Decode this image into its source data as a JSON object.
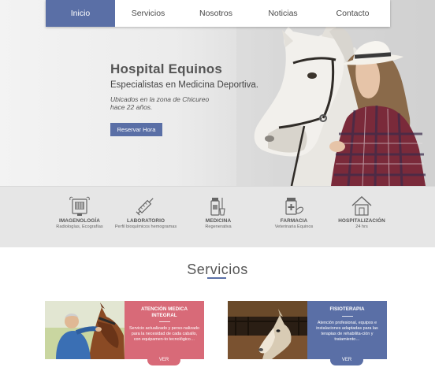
{
  "colors": {
    "accent": "#5a6fa6",
    "card_pink": "#d86a78",
    "card_blue": "#5a6fa6",
    "feature_band": "#e6e6e6"
  },
  "nav": {
    "items": [
      {
        "label": "Inicio",
        "active": true
      },
      {
        "label": "Servicios",
        "active": false
      },
      {
        "label": "Nosotros",
        "active": false
      },
      {
        "label": "Noticias",
        "active": false
      },
      {
        "label": "Contacto",
        "active": false
      }
    ]
  },
  "hero": {
    "title": "Hospital Equinos",
    "subtitle": "Especialistas en Medicina  Deportiva.",
    "description": "Ubicados en la zona de Chicureo hace 22 años.",
    "button": "Reservar Hora"
  },
  "features": [
    {
      "icon": "x-ray-monitor-icon",
      "title": "IMAGENOLOGÍA",
      "subtitle": "Radiologías, Ecografías"
    },
    {
      "icon": "syringe-icon",
      "title": "LABORATORIO",
      "subtitle": "Perfil bioquímicos hemogramas"
    },
    {
      "icon": "medicine-bottle-icon",
      "title": "MEDICINA",
      "subtitle": "Regenerativa"
    },
    {
      "icon": "pharmacy-icon",
      "title": "FARMACIA",
      "subtitle": "Veterinaria Equinos"
    },
    {
      "icon": "house-icon",
      "title": "HOSPITALIZACIÓN",
      "subtitle": "24 hrs"
    }
  ],
  "services": {
    "title": "Servicios",
    "cards": [
      {
        "title": "ATENCIÓN MEDICA INTEGRAL",
        "description": "Servicio actualizado y perso-nalizado para la necesidad de cada caballo, con equipamen-to tecnológico…",
        "button": "VER"
      },
      {
        "title": "FISIOTERAPIA",
        "description": "Atención profesional, equipos e instalaciones adaptadas para las terapias de rehabilita-ción y tratamiento…",
        "button": "VER"
      }
    ]
  }
}
